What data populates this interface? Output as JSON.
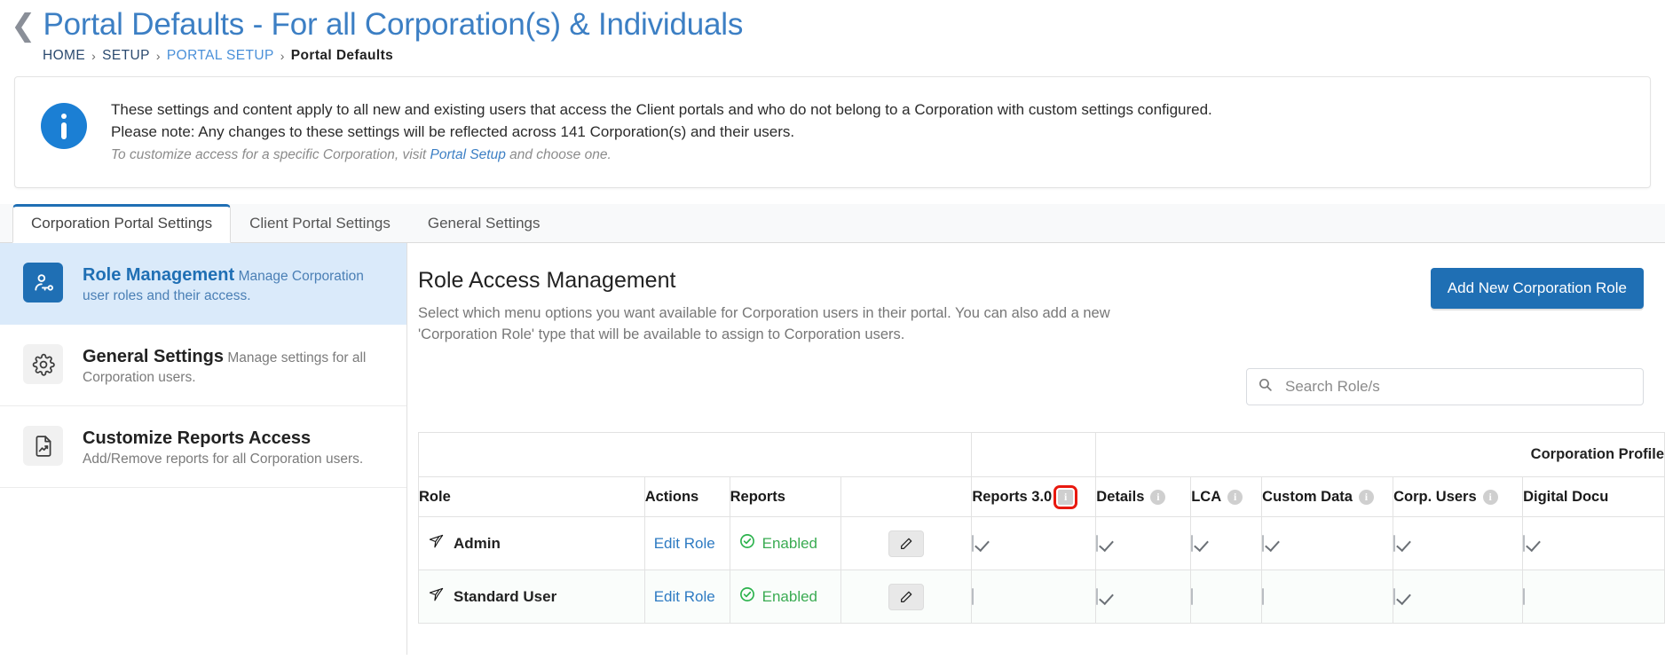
{
  "header": {
    "back_icon": "chevron-left-icon",
    "title": "Portal Defaults - For all Corporation(s) & Individuals",
    "breadcrumb": [
      {
        "label": "HOME",
        "style": "dark"
      },
      {
        "label": "SETUP",
        "style": "dark"
      },
      {
        "label": "PORTAL SETUP",
        "style": "blue"
      },
      {
        "label": "Portal Defaults",
        "style": "current"
      }
    ],
    "breadcrumb_separator": "›"
  },
  "banner": {
    "icon": "info-circle-icon",
    "line1": "These settings and content apply to all new and existing users that access the Client portals and who do not belong to a Corporation with custom settings configured.",
    "line2": "Please note: Any changes to these settings will be reflected across 141 Corporation(s) and their users.",
    "note_prefix": "To customize access for a specific Corporation, visit ",
    "note_link": "Portal Setup",
    "note_suffix": " and choose one."
  },
  "tabs": [
    {
      "label": "Corporation Portal Settings",
      "active": true
    },
    {
      "label": "Client Portal Settings",
      "active": false
    },
    {
      "label": "General Settings",
      "active": false
    }
  ],
  "sidebar": {
    "items": [
      {
        "icon": "user-key-icon",
        "title": "Role Management",
        "subtitle": "Manage Corporation user roles and their access.",
        "active": true
      },
      {
        "icon": "gear-icon",
        "title": "General Settings",
        "subtitle": "Manage settings for all Corporation users.",
        "active": false
      },
      {
        "icon": "report-document-icon",
        "title": "Customize Reports Access",
        "subtitle": "Add/Remove reports for all Corporation users.",
        "active": false
      }
    ]
  },
  "main": {
    "title": "Role Access Management",
    "description": "Select which menu options you want available for Corporation users in their portal. You can also add a new 'Corporation Role' type that will be available to assign to Corporation users.",
    "add_button": "Add New Corporation Role",
    "search": {
      "icon": "search-icon",
      "placeholder": "Search Role/s",
      "value": ""
    }
  },
  "table": {
    "group_header": {
      "left_label": "",
      "mid_label": "",
      "right_label": "Corporation Profile"
    },
    "columns": [
      {
        "key": "role",
        "label": "Role",
        "info": false,
        "align": "left"
      },
      {
        "key": "actions",
        "label": "Actions",
        "info": false,
        "align": "left"
      },
      {
        "key": "reports",
        "label": "Reports",
        "info": false,
        "align": "left"
      },
      {
        "key": "edit",
        "label": "",
        "info": false,
        "align": "center"
      },
      {
        "key": "reports30",
        "label": "Reports 3.0",
        "info": true,
        "align": "left",
        "highlighted": true
      },
      {
        "key": "details",
        "label": "Details",
        "info": true,
        "align": "left"
      },
      {
        "key": "lca",
        "label": "LCA",
        "info": true,
        "align": "left"
      },
      {
        "key": "custom_data",
        "label": "Custom Data",
        "info": true,
        "align": "left"
      },
      {
        "key": "corp_users",
        "label": "Corp. Users",
        "info": true,
        "align": "left"
      },
      {
        "key": "digital_docs",
        "label": "Digital Docu",
        "info": false,
        "align": "left"
      }
    ],
    "rows": [
      {
        "icon": "bird-icon",
        "role": "Admin",
        "action_label": "Edit Role",
        "reports_status": "Enabled",
        "reports_status_icon": "check-circle-icon",
        "edit_icon": "pencil-icon",
        "checks": {
          "reports30": true,
          "details": true,
          "lca": true,
          "custom_data": true,
          "corp_users": true,
          "digital_docs": true
        }
      },
      {
        "icon": "bird-icon",
        "role": "Standard User",
        "action_label": "Edit Role",
        "reports_status": "Enabled",
        "reports_status_icon": "check-circle-icon",
        "edit_icon": "pencil-icon",
        "checks": {
          "reports30": false,
          "details": true,
          "lca": false,
          "custom_data": false,
          "corp_users": true,
          "digital_docs": false
        }
      }
    ]
  },
  "colors": {
    "accent_blue": "#1f6fb4",
    "title_blue": "#3c7fc4",
    "link_blue": "#2d7ac2",
    "success_green": "#3aab52",
    "highlight_red": "#e8190f",
    "active_row_bg": "#daeafa"
  }
}
